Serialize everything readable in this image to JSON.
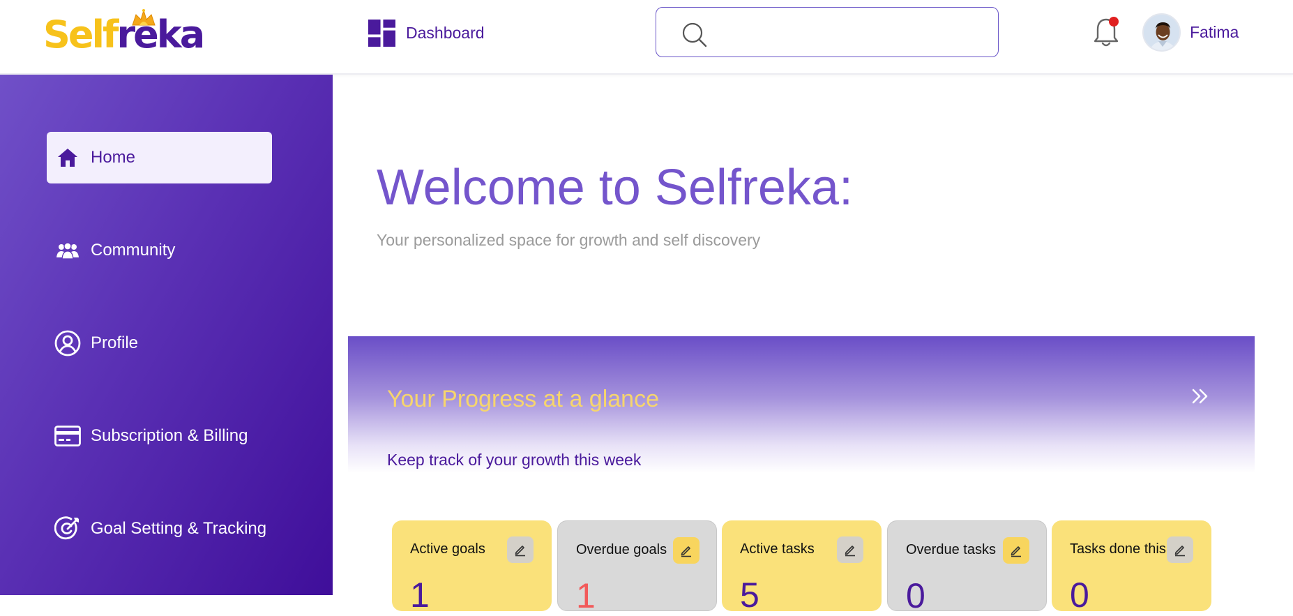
{
  "header": {
    "logo": {
      "part1": "Self",
      "part2": "reka"
    },
    "dashboard_label": "Dashboard",
    "search": {
      "value": "",
      "placeholder": ""
    },
    "notifications": {
      "has_unread": true
    },
    "user": {
      "name": "Fatima"
    }
  },
  "sidebar": {
    "items": [
      {
        "label": "Home",
        "icon": "home-icon",
        "active": true
      },
      {
        "label": "Community",
        "icon": "people-icon",
        "active": false
      },
      {
        "label": "Profile",
        "icon": "user-circle-icon",
        "active": false
      },
      {
        "label": "Subscription & Billing",
        "icon": "credit-card-icon",
        "active": false
      },
      {
        "label": "Goal Setting & Tracking",
        "icon": "target-icon",
        "active": false
      }
    ]
  },
  "main": {
    "welcome_title": "Welcome to Selfreka:",
    "welcome_subtitle": "Your personalized space for growth and self discovery",
    "progress": {
      "title": "Your Progress at a glance",
      "subtitle": "Keep track of your growth this week"
    },
    "stats": [
      {
        "label": "Active goals",
        "value": "1",
        "style": "yellow"
      },
      {
        "label": "Overdue goals",
        "value": "1",
        "style": "gray"
      },
      {
        "label": "Active tasks",
        "value": "5",
        "style": "yellow"
      },
      {
        "label": "Overdue tasks",
        "value": "0",
        "style": "gray"
      },
      {
        "label": "Tasks done this week",
        "value": "0",
        "style": "yellow"
      }
    ]
  },
  "colors": {
    "brand_purple": "#4a1a9c",
    "brand_yellow": "#f7c21b",
    "heading_purple": "#7455cc",
    "card_yellow": "#fae17a",
    "card_gray": "#d9d9d9",
    "alert_red": "#f25a5a",
    "notification_dot": "#e02020"
  }
}
